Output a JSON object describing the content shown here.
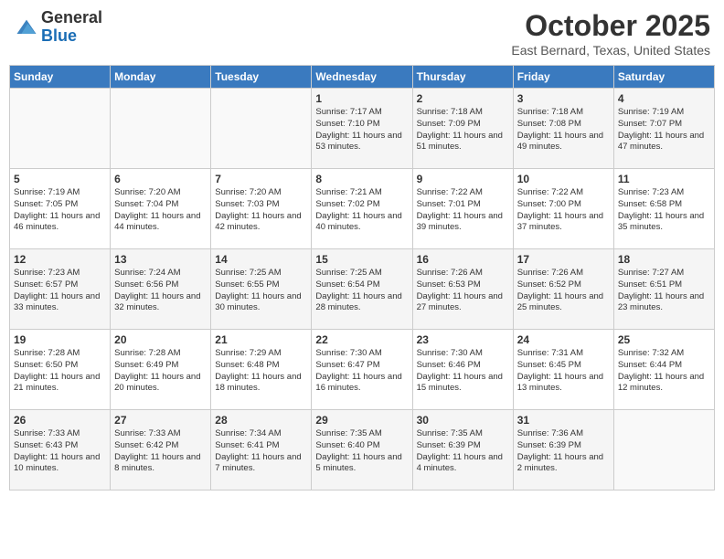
{
  "header": {
    "logo_general": "General",
    "logo_blue": "Blue",
    "month": "October 2025",
    "location": "East Bernard, Texas, United States"
  },
  "days_of_week": [
    "Sunday",
    "Monday",
    "Tuesday",
    "Wednesday",
    "Thursday",
    "Friday",
    "Saturday"
  ],
  "weeks": [
    [
      {
        "day": "",
        "info": ""
      },
      {
        "day": "",
        "info": ""
      },
      {
        "day": "",
        "info": ""
      },
      {
        "day": "1",
        "info": "Sunrise: 7:17 AM\nSunset: 7:10 PM\nDaylight: 11 hours and 53 minutes."
      },
      {
        "day": "2",
        "info": "Sunrise: 7:18 AM\nSunset: 7:09 PM\nDaylight: 11 hours and 51 minutes."
      },
      {
        "day": "3",
        "info": "Sunrise: 7:18 AM\nSunset: 7:08 PM\nDaylight: 11 hours and 49 minutes."
      },
      {
        "day": "4",
        "info": "Sunrise: 7:19 AM\nSunset: 7:07 PM\nDaylight: 11 hours and 47 minutes."
      }
    ],
    [
      {
        "day": "5",
        "info": "Sunrise: 7:19 AM\nSunset: 7:05 PM\nDaylight: 11 hours and 46 minutes."
      },
      {
        "day": "6",
        "info": "Sunrise: 7:20 AM\nSunset: 7:04 PM\nDaylight: 11 hours and 44 minutes."
      },
      {
        "day": "7",
        "info": "Sunrise: 7:20 AM\nSunset: 7:03 PM\nDaylight: 11 hours and 42 minutes."
      },
      {
        "day": "8",
        "info": "Sunrise: 7:21 AM\nSunset: 7:02 PM\nDaylight: 11 hours and 40 minutes."
      },
      {
        "day": "9",
        "info": "Sunrise: 7:22 AM\nSunset: 7:01 PM\nDaylight: 11 hours and 39 minutes."
      },
      {
        "day": "10",
        "info": "Sunrise: 7:22 AM\nSunset: 7:00 PM\nDaylight: 11 hours and 37 minutes."
      },
      {
        "day": "11",
        "info": "Sunrise: 7:23 AM\nSunset: 6:58 PM\nDaylight: 11 hours and 35 minutes."
      }
    ],
    [
      {
        "day": "12",
        "info": "Sunrise: 7:23 AM\nSunset: 6:57 PM\nDaylight: 11 hours and 33 minutes."
      },
      {
        "day": "13",
        "info": "Sunrise: 7:24 AM\nSunset: 6:56 PM\nDaylight: 11 hours and 32 minutes."
      },
      {
        "day": "14",
        "info": "Sunrise: 7:25 AM\nSunset: 6:55 PM\nDaylight: 11 hours and 30 minutes."
      },
      {
        "day": "15",
        "info": "Sunrise: 7:25 AM\nSunset: 6:54 PM\nDaylight: 11 hours and 28 minutes."
      },
      {
        "day": "16",
        "info": "Sunrise: 7:26 AM\nSunset: 6:53 PM\nDaylight: 11 hours and 27 minutes."
      },
      {
        "day": "17",
        "info": "Sunrise: 7:26 AM\nSunset: 6:52 PM\nDaylight: 11 hours and 25 minutes."
      },
      {
        "day": "18",
        "info": "Sunrise: 7:27 AM\nSunset: 6:51 PM\nDaylight: 11 hours and 23 minutes."
      }
    ],
    [
      {
        "day": "19",
        "info": "Sunrise: 7:28 AM\nSunset: 6:50 PM\nDaylight: 11 hours and 21 minutes."
      },
      {
        "day": "20",
        "info": "Sunrise: 7:28 AM\nSunset: 6:49 PM\nDaylight: 11 hours and 20 minutes."
      },
      {
        "day": "21",
        "info": "Sunrise: 7:29 AM\nSunset: 6:48 PM\nDaylight: 11 hours and 18 minutes."
      },
      {
        "day": "22",
        "info": "Sunrise: 7:30 AM\nSunset: 6:47 PM\nDaylight: 11 hours and 16 minutes."
      },
      {
        "day": "23",
        "info": "Sunrise: 7:30 AM\nSunset: 6:46 PM\nDaylight: 11 hours and 15 minutes."
      },
      {
        "day": "24",
        "info": "Sunrise: 7:31 AM\nSunset: 6:45 PM\nDaylight: 11 hours and 13 minutes."
      },
      {
        "day": "25",
        "info": "Sunrise: 7:32 AM\nSunset: 6:44 PM\nDaylight: 11 hours and 12 minutes."
      }
    ],
    [
      {
        "day": "26",
        "info": "Sunrise: 7:33 AM\nSunset: 6:43 PM\nDaylight: 11 hours and 10 minutes."
      },
      {
        "day": "27",
        "info": "Sunrise: 7:33 AM\nSunset: 6:42 PM\nDaylight: 11 hours and 8 minutes."
      },
      {
        "day": "28",
        "info": "Sunrise: 7:34 AM\nSunset: 6:41 PM\nDaylight: 11 hours and 7 minutes."
      },
      {
        "day": "29",
        "info": "Sunrise: 7:35 AM\nSunset: 6:40 PM\nDaylight: 11 hours and 5 minutes."
      },
      {
        "day": "30",
        "info": "Sunrise: 7:35 AM\nSunset: 6:39 PM\nDaylight: 11 hours and 4 minutes."
      },
      {
        "day": "31",
        "info": "Sunrise: 7:36 AM\nSunset: 6:39 PM\nDaylight: 11 hours and 2 minutes."
      },
      {
        "day": "",
        "info": ""
      }
    ]
  ]
}
